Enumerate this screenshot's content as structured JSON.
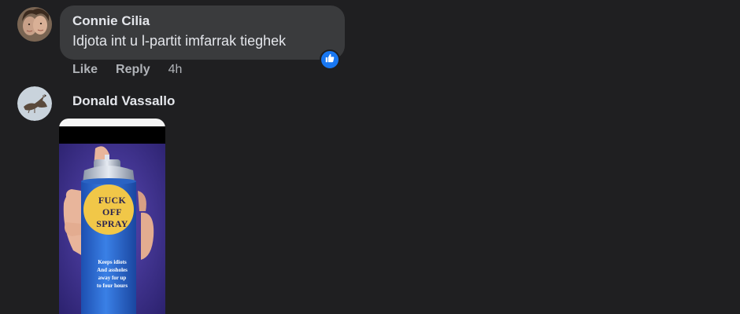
{
  "comments": [
    {
      "author": "Connie Cilia",
      "text": "Idjota int u l-partit imfarrak tieghek",
      "actions": {
        "like": "Like",
        "reply": "Reply",
        "time": "4h"
      },
      "reaction": "like-icon"
    },
    {
      "author": "Donald Vassallo",
      "attachment": {
        "label_lines": [
          "FUCK",
          "OFF",
          "SPRAY"
        ],
        "sub_lines": [
          "Keeps idiots",
          "And assholes",
          "away for up",
          "to four hours"
        ]
      }
    }
  ],
  "colors": {
    "background": "#1f1f21",
    "bubble": "#3a3b3d",
    "text_primary": "#e4e6eb",
    "text_secondary": "#b0b3b8",
    "like_blue": "#1877f2",
    "can_blue": "#2f6fd6",
    "label_yellow": "#f1c748"
  }
}
